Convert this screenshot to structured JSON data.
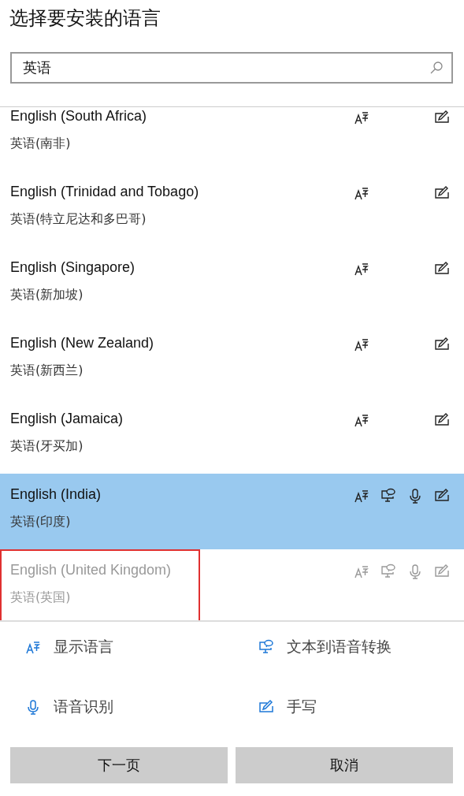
{
  "title": "选择要安装的语言",
  "search": {
    "value": "英语"
  },
  "languages": [
    {
      "name": "English (South Africa)",
      "native": "英语(南非)",
      "selected": false,
      "disabled": false,
      "highlighted": false,
      "features": {
        "display": true,
        "tts": false,
        "speech": false,
        "handwriting": true
      }
    },
    {
      "name": "English (Trinidad and Tobago)",
      "native": "英语(特立尼达和多巴哥)",
      "selected": false,
      "disabled": false,
      "highlighted": false,
      "features": {
        "display": true,
        "tts": false,
        "speech": false,
        "handwriting": true
      }
    },
    {
      "name": "English (Singapore)",
      "native": "英语(新加坡)",
      "selected": false,
      "disabled": false,
      "highlighted": false,
      "features": {
        "display": true,
        "tts": false,
        "speech": false,
        "handwriting": true
      }
    },
    {
      "name": "English (New Zealand)",
      "native": "英语(新西兰)",
      "selected": false,
      "disabled": false,
      "highlighted": false,
      "features": {
        "display": true,
        "tts": false,
        "speech": false,
        "handwriting": true
      }
    },
    {
      "name": "English (Jamaica)",
      "native": "英语(牙买加)",
      "selected": false,
      "disabled": false,
      "highlighted": false,
      "features": {
        "display": true,
        "tts": false,
        "speech": false,
        "handwriting": true
      }
    },
    {
      "name": "English (India)",
      "native": "英语(印度)",
      "selected": true,
      "disabled": false,
      "highlighted": false,
      "features": {
        "display": true,
        "tts": true,
        "speech": true,
        "handwriting": true
      }
    },
    {
      "name": "English (United Kingdom)",
      "native": "英语(英国)",
      "selected": false,
      "disabled": true,
      "highlighted": true,
      "features": {
        "display": true,
        "tts": true,
        "speech": true,
        "handwriting": true
      }
    }
  ],
  "legend": [
    {
      "kind": "display",
      "label": "显示语言"
    },
    {
      "kind": "tts",
      "label": "文本到语音转换"
    },
    {
      "kind": "speech",
      "label": "语音识别"
    },
    {
      "kind": "handwriting",
      "label": "手写"
    }
  ],
  "buttons": [
    "下一页",
    "取消"
  ]
}
